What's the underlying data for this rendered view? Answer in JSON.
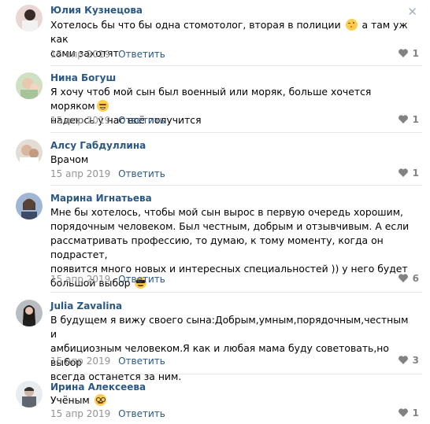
{
  "reply_label": "Ответить",
  "comments": [
    {
      "author": "Юлия Кузнецова",
      "text": "Хотелось бы что бы одна стомотолог, вторая в полиции",
      "text_after": "а там уж как\nсами захотят",
      "date": "15 апр 2019",
      "likes": "1",
      "emoji": "winking-face"
    },
    {
      "author": "Нина Богуш",
      "text": "Я хочу чтоб мой сын был военный или моряк, больше хочется моряком",
      "text_after": "\nнадеюсь у нас всё получится",
      "date": "15 апр 2019",
      "likes": "1",
      "emoji": "smiling-face"
    },
    {
      "author": "Алсу Габдуллина",
      "text": "Врачом",
      "date": "15 апр 2019",
      "likes": "1"
    },
    {
      "author": "Марина Игнатьева",
      "text": "Мне бы хотелось, чтобы мой сын вырос в первую очередь хорошим,\nпорядочным человеком. Был честным, добрым и отзывчивым. А если\nрассматривать профессию, то думаю, к тому моменту, когда он подрастет,\nпоявится много новых и интересных специальностей )) у него будет\nбольшой выбор",
      "date": "15 апр 2019",
      "likes": "6",
      "emoji": "sunglasses-face"
    },
    {
      "author": "Julia Zavalina",
      "text": "В будущем я вижу своего сына:Добрым,умным,порядочным,честным и\nамбициозным человеком.Я как и любая мама буду советовать,но выбор\nвсегда останется за ним.",
      "date": "15 апр 2019",
      "likes": "3"
    },
    {
      "author": "Ирина Алексеева",
      "text": "Учёным",
      "date": "15 апр 2019",
      "likes": "1",
      "emoji": "nerd-face"
    }
  ],
  "colors": {
    "author": "#2a5885",
    "date": "#939393",
    "divider": "#e7e8ec"
  }
}
